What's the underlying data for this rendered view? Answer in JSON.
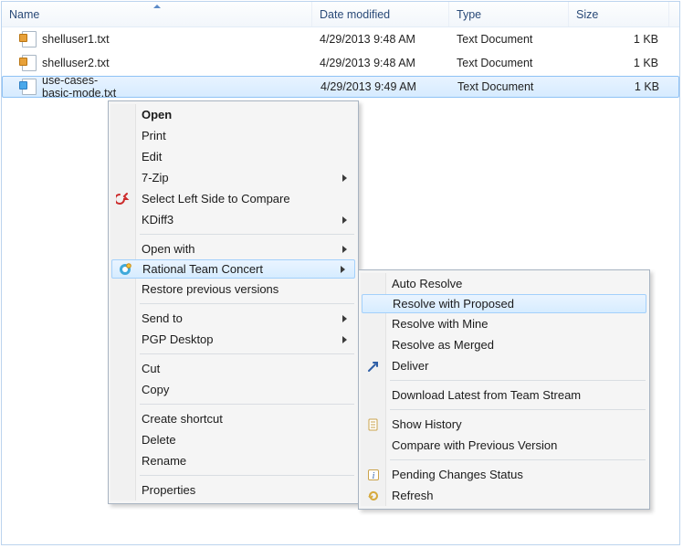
{
  "columns": {
    "name": "Name",
    "date": "Date modified",
    "type": "Type",
    "size": "Size"
  },
  "rows": [
    {
      "name": "shelluser1.txt",
      "date": "4/29/2013 9:48 AM",
      "type": "Text Document",
      "size": "1 KB",
      "selected": false
    },
    {
      "name": "shelluser2.txt",
      "date": "4/29/2013 9:48 AM",
      "type": "Text Document",
      "size": "1 KB",
      "selected": false
    },
    {
      "name": "use-cases-basic-mode.txt",
      "date": "4/29/2013 9:49 AM",
      "type": "Text Document",
      "size": "1 KB",
      "selected": true
    }
  ],
  "menu1": {
    "open": "Open",
    "print": "Print",
    "edit": "Edit",
    "sevenzip": "7-Zip",
    "select_left": "Select Left Side to Compare",
    "kdiff3": "KDiff3",
    "open_with": "Open with",
    "rtc": "Rational Team Concert",
    "restore": "Restore previous versions",
    "send_to": "Send to",
    "pgp": "PGP Desktop",
    "cut": "Cut",
    "copy": "Copy",
    "shortcut": "Create shortcut",
    "delete": "Delete",
    "rename": "Rename",
    "properties": "Properties"
  },
  "menu2": {
    "auto_resolve": "Auto Resolve",
    "resolve_proposed": "Resolve with Proposed",
    "resolve_mine": "Resolve with Mine",
    "resolve_merged": "Resolve as Merged",
    "deliver": "Deliver",
    "download_latest": "Download Latest from Team Stream",
    "show_history": "Show History",
    "compare_prev": "Compare with Previous Version",
    "pending_status": "Pending Changes Status",
    "refresh": "Refresh"
  }
}
